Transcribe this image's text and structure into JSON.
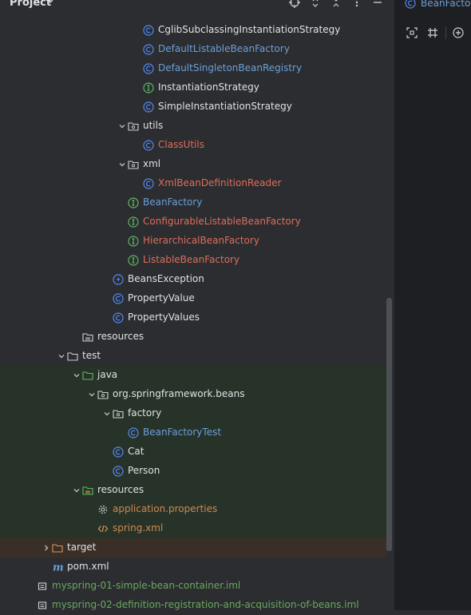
{
  "header": {
    "title": "Project",
    "icons": [
      "locate-icon",
      "expand-collapse-icon",
      "collapse-all-icon",
      "more-options-icon",
      "hide-icon"
    ]
  },
  "editor": {
    "tab_label": "BeanFactor",
    "toolbar_icons": [
      "fit-screen-icon",
      "grid-icon",
      "zoom-in-icon"
    ]
  },
  "tree": {
    "rows": [
      {
        "label": "CglibSubclassingInstantiationStrategy",
        "icon": "class-icon",
        "color": "#dfe1e5"
      },
      {
        "label": "DefaultListableBeanFactory",
        "icon": "class-icon",
        "color": "#6c9fd8"
      },
      {
        "label": "DefaultSingletonBeanRegistry",
        "icon": "class-icon",
        "color": "#6c9fd8"
      },
      {
        "label": "InstantiationStrategy",
        "icon": "interface-icon",
        "color": "#dfe1e5"
      },
      {
        "label": "SimpleInstantiationStrategy",
        "icon": "class-icon",
        "color": "#dfe1e5"
      },
      {
        "label": "utils",
        "icon": "package-icon",
        "color": "#dfe1e5",
        "expanded": true
      },
      {
        "label": "ClassUtils",
        "icon": "class-icon",
        "color": "#e06c5a"
      },
      {
        "label": "xml",
        "icon": "package-icon",
        "color": "#dfe1e5",
        "expanded": true
      },
      {
        "label": "XmlBeanDefinitionReader",
        "icon": "class-icon",
        "color": "#e06c5a"
      },
      {
        "label": "BeanFactory",
        "icon": "interface-icon",
        "color": "#6c9fd8"
      },
      {
        "label": "ConfigurableListableBeanFactory",
        "icon": "interface-icon",
        "color": "#e06c5a"
      },
      {
        "label": "HierarchicalBeanFactory",
        "icon": "interface-icon",
        "color": "#e06c5a"
      },
      {
        "label": "ListableBeanFactory",
        "icon": "interface-icon",
        "color": "#e06c5a"
      },
      {
        "label": "BeansException",
        "icon": "exception-icon",
        "color": "#dfe1e5"
      },
      {
        "label": "PropertyValue",
        "icon": "class-icon",
        "color": "#dfe1e5"
      },
      {
        "label": "PropertyValues",
        "icon": "class-icon",
        "color": "#dfe1e5"
      },
      {
        "label": "resources",
        "icon": "resources-folder-icon",
        "color": "#dfe1e5"
      },
      {
        "label": "test",
        "icon": "folder-icon",
        "color": "#dfe1e5",
        "expanded": true
      },
      {
        "label": "java",
        "icon": "test-source-folder-icon",
        "color": "#dfe1e5",
        "expanded": true
      },
      {
        "label": "org.springframework.beans",
        "icon": "package-icon",
        "color": "#dfe1e5",
        "expanded": true
      },
      {
        "label": "factory",
        "icon": "package-icon",
        "color": "#dfe1e5",
        "expanded": true
      },
      {
        "label": "BeanFactoryTest",
        "icon": "class-icon",
        "color": "#6c9fd8"
      },
      {
        "label": "Cat",
        "icon": "class-icon",
        "color": "#dfe1e5"
      },
      {
        "label": "Person",
        "icon": "class-icon",
        "color": "#dfe1e5"
      },
      {
        "label": "resources",
        "icon": "test-resources-folder-icon",
        "color": "#dfe1e5",
        "expanded": true
      },
      {
        "label": "application.properties",
        "icon": "gear-icon",
        "color": "#d08850"
      },
      {
        "label": "spring.xml",
        "icon": "xml-icon",
        "color": "#d08850"
      },
      {
        "label": "target",
        "icon": "excluded-folder-icon",
        "color": "#dfe1e5",
        "expanded": false
      },
      {
        "label": "pom.xml",
        "icon": "maven-icon",
        "color": "#dfe1e5"
      },
      {
        "label": "myspring-01-simple-bean-container.iml",
        "icon": "iml-file-icon",
        "color": "#6aa85e"
      },
      {
        "label": "myspring-02-definition-registration-and-acquisition-of-beans.iml",
        "icon": "iml-file-icon",
        "color": "#6aa85e"
      }
    ]
  }
}
